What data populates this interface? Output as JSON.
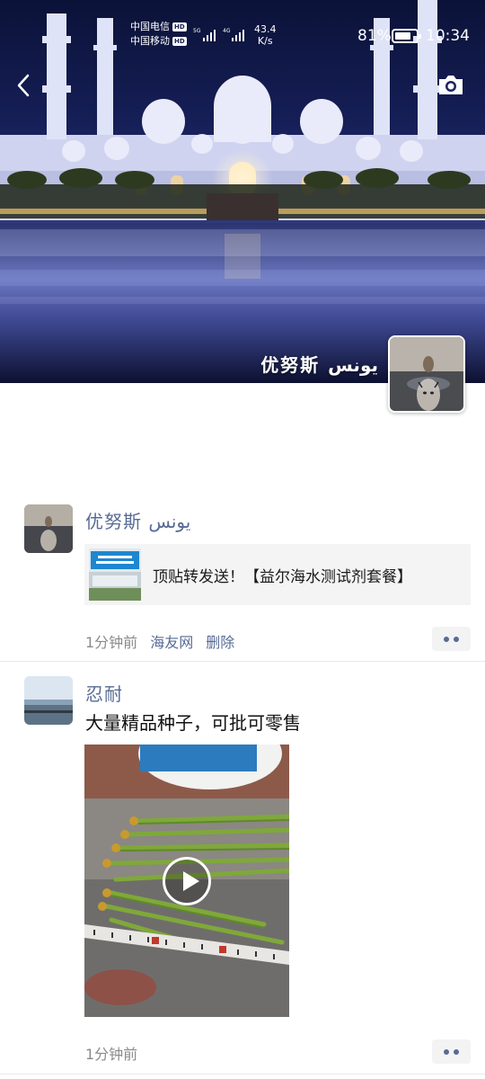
{
  "status_bar": {
    "carrier_1": "中国电信",
    "carrier_2": "中国移动",
    "hd": "HD",
    "network_5g": "5G",
    "network_4g": "4G",
    "speed_value": "43.4",
    "speed_unit": "K/s",
    "battery_percent": "81%",
    "battery_level": 0.81,
    "time": "10:34"
  },
  "header": {
    "back_icon": "chevron-left-icon",
    "camera_icon": "camera-icon",
    "cover_name": "优努斯 يونس",
    "cover_avatar": "tiger-reflection-avatar"
  },
  "posts": [
    {
      "author": "优努斯 يونس",
      "share_text": "顶贴转发送！【益尔海水测试剂套餐】",
      "time": "1分钟前",
      "source": "海友网",
      "delete": "删除",
      "more_icon": "more-dots-icon"
    },
    {
      "author": "忍耐",
      "text": "大量精品种子，可批可零售",
      "video_icon": "play-icon",
      "time": "1分钟前",
      "more_icon": "more-dots-icon"
    }
  ],
  "colors": {
    "name_blue": "#576b95",
    "meta_gray": "#8a8a8a",
    "share_bg": "#f4f4f4"
  }
}
